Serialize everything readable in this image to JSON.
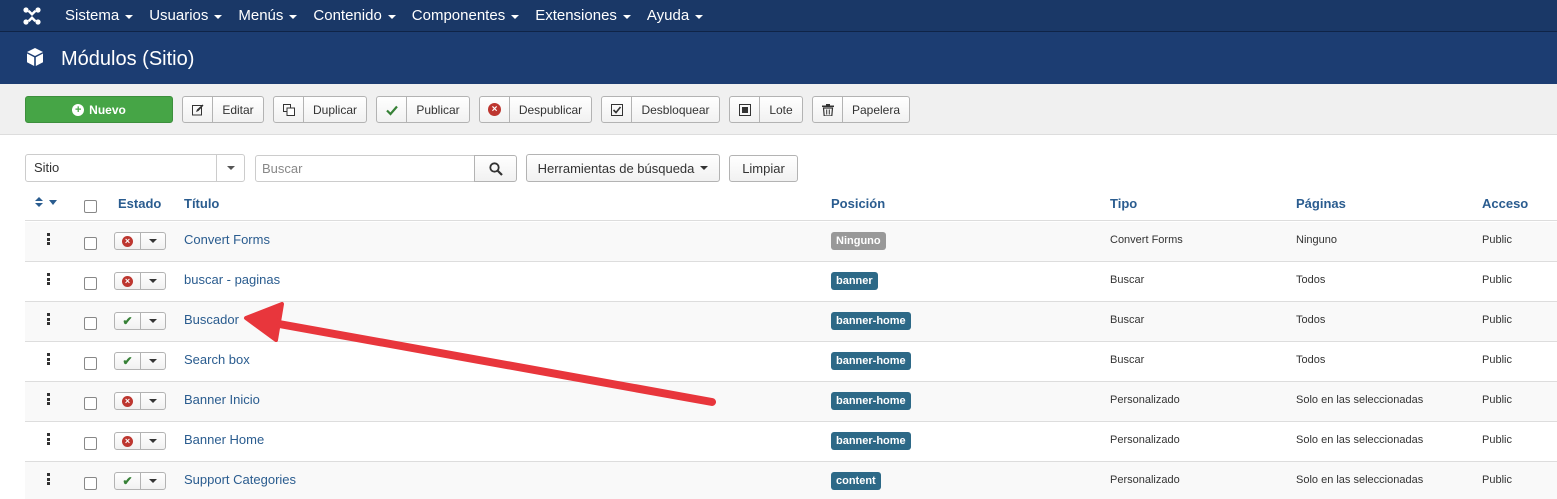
{
  "topbar": {
    "menu": [
      {
        "label": "Sistema"
      },
      {
        "label": "Usuarios"
      },
      {
        "label": "Menús"
      },
      {
        "label": "Contenido"
      },
      {
        "label": "Componentes"
      },
      {
        "label": "Extensiones"
      },
      {
        "label": "Ayuda"
      }
    ]
  },
  "page": {
    "title": "Módulos (Sitio)"
  },
  "toolbar": {
    "new_label": "Nuevo",
    "buttons": [
      {
        "label": "Editar",
        "icon": "edit-icon"
      },
      {
        "label": "Duplicar",
        "icon": "copy-icon"
      },
      {
        "label": "Publicar",
        "icon": "check-icon"
      },
      {
        "label": "Despublicar",
        "icon": "unpublish-icon"
      },
      {
        "label": "Desbloquear",
        "icon": "checkin-icon"
      },
      {
        "label": "Lote",
        "icon": "batch-icon"
      },
      {
        "label": "Papelera",
        "icon": "trash-icon"
      }
    ]
  },
  "filters": {
    "client_value": "Sitio",
    "search_placeholder": "Buscar",
    "search_tools_label": "Herramientas de búsqueda",
    "clear_label": "Limpiar"
  },
  "table": {
    "headers": {
      "estado": "Estado",
      "titulo": "Título",
      "posicion": "Posición",
      "tipo": "Tipo",
      "paginas": "Páginas",
      "acceso": "Acceso"
    },
    "rows": [
      {
        "title": "Convert Forms",
        "status": "unpublished",
        "position": "Ninguno",
        "position_color": "#999999",
        "type": "Convert Forms",
        "pages": "Ninguno",
        "access": "Public"
      },
      {
        "title": "buscar - paginas",
        "status": "unpublished",
        "position": "banner",
        "position_color": "#2d6987",
        "type": "Buscar",
        "pages": "Todos",
        "access": "Public"
      },
      {
        "title": "Buscador",
        "status": "published",
        "position": "banner-home",
        "position_color": "#2d6987",
        "type": "Buscar",
        "pages": "Todos",
        "access": "Public"
      },
      {
        "title": "Search box",
        "status": "published",
        "position": "banner-home",
        "position_color": "#2d6987",
        "type": "Buscar",
        "pages": "Todos",
        "access": "Public"
      },
      {
        "title": "Banner Inicio",
        "status": "unpublished",
        "position": "banner-home",
        "position_color": "#2d6987",
        "type": "Personalizado",
        "pages": "Solo en las seleccionadas",
        "access": "Public"
      },
      {
        "title": "Banner Home",
        "status": "unpublished",
        "position": "banner-home",
        "position_color": "#2d6987",
        "type": "Personalizado",
        "pages": "Solo en las seleccionadas",
        "access": "Public"
      },
      {
        "title": "Support Categories",
        "status": "published",
        "position": "content",
        "position_color": "#2d6987",
        "type": "Personalizado",
        "pages": "Solo en las seleccionadas",
        "access": "Public"
      }
    ]
  },
  "colors": {
    "topbar": "#1a3867",
    "titlebar": "#1c3d72",
    "new_button": "#46a546",
    "link": "#2a5c8f",
    "annotation_arrow": "#e8363c"
  }
}
